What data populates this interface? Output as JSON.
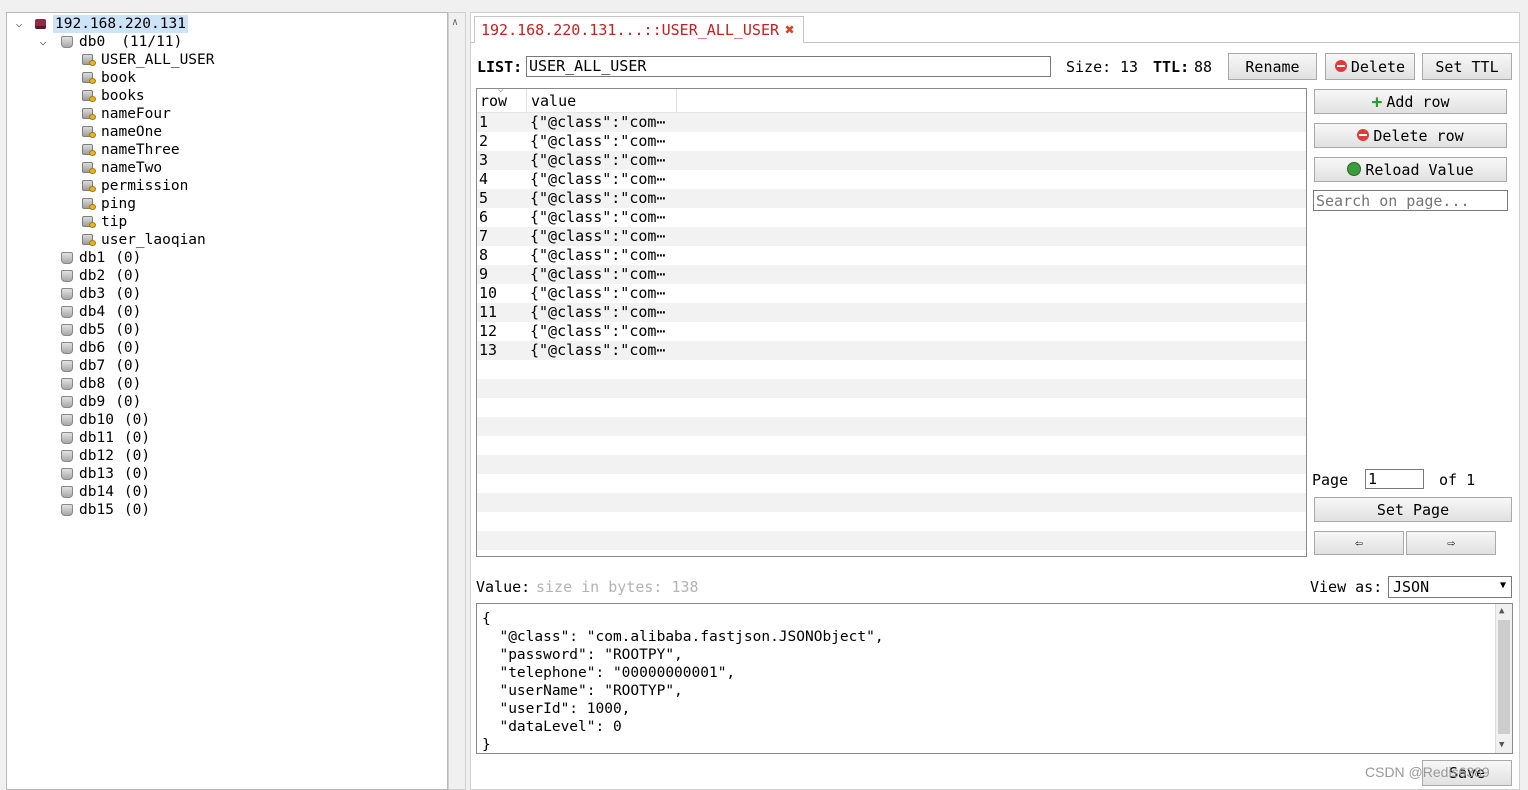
{
  "tree": {
    "server": "192.168.220.131",
    "db0": {
      "name": "db0",
      "count": "(11/11)"
    },
    "keys": [
      "USER_ALL_USER",
      "book",
      "books",
      "nameFour",
      "nameOne",
      "nameThree",
      "nameTwo",
      "permission",
      "ping",
      "tip",
      "user_laoqian"
    ],
    "dbs": [
      {
        "name": "db1",
        "count": "(0)"
      },
      {
        "name": "db2",
        "count": "(0)"
      },
      {
        "name": "db3",
        "count": "(0)"
      },
      {
        "name": "db4",
        "count": "(0)"
      },
      {
        "name": "db5",
        "count": "(0)"
      },
      {
        "name": "db6",
        "count": "(0)"
      },
      {
        "name": "db7",
        "count": "(0)"
      },
      {
        "name": "db8",
        "count": "(0)"
      },
      {
        "name": "db9",
        "count": "(0)"
      },
      {
        "name": "db10",
        "count": "(0)"
      },
      {
        "name": "db11",
        "count": "(0)"
      },
      {
        "name": "db12",
        "count": "(0)"
      },
      {
        "name": "db13",
        "count": "(0)"
      },
      {
        "name": "db14",
        "count": "(0)"
      },
      {
        "name": "db15",
        "count": "(0)"
      }
    ]
  },
  "tab": {
    "label": "192.168.220.131...::USER_ALL_USER"
  },
  "key_header": {
    "type_label": "LIST:",
    "key_name": "USER_ALL_USER",
    "size_label": "Size:",
    "size_value": "13",
    "ttl_label": "TTL:",
    "ttl_value": "88",
    "rename": "Rename",
    "delete": "Delete",
    "set_ttl": "Set TTL"
  },
  "table": {
    "columns": [
      "row",
      "value"
    ],
    "rows": [
      {
        "row": "1",
        "value": "{\"@class\":\"com⋯"
      },
      {
        "row": "2",
        "value": "{\"@class\":\"com⋯"
      },
      {
        "row": "3",
        "value": "{\"@class\":\"com⋯"
      },
      {
        "row": "4",
        "value": "{\"@class\":\"com⋯"
      },
      {
        "row": "5",
        "value": "{\"@class\":\"com⋯"
      },
      {
        "row": "6",
        "value": "{\"@class\":\"com⋯"
      },
      {
        "row": "7",
        "value": "{\"@class\":\"com⋯"
      },
      {
        "row": "8",
        "value": "{\"@class\":\"com⋯"
      },
      {
        "row": "9",
        "value": "{\"@class\":\"com⋯"
      },
      {
        "row": "10",
        "value": "{\"@class\":\"com⋯"
      },
      {
        "row": "11",
        "value": "{\"@class\":\"com⋯"
      },
      {
        "row": "12",
        "value": "{\"@class\":\"com⋯"
      },
      {
        "row": "13",
        "value": "{\"@class\":\"com⋯"
      }
    ]
  },
  "side": {
    "add_row": "Add row",
    "delete_row": "Delete row",
    "reload_value": "Reload Value",
    "search_placeholder": "Search on page...",
    "page_label": "Page",
    "page_value": "1",
    "of_label": "of 1",
    "set_page": "Set Page",
    "prev": "⇦",
    "next": "⇨"
  },
  "value": {
    "label": "Value:",
    "size_hint": "size in bytes: 138",
    "view_as_label": "View as:",
    "view_as_value": "JSON",
    "content": "{\n  \"@class\": \"com.alibaba.fastjson.JSONObject\",\n  \"password\": \"ROOTPY\",\n  \"telephone\": \"00000000001\",\n  \"userName\": \"ROOTYP\",\n  \"userId\": 1000,\n  \"dataLevel\": 0\n}",
    "save": "Save"
  },
  "watermark": "CSDN @Redis6389"
}
